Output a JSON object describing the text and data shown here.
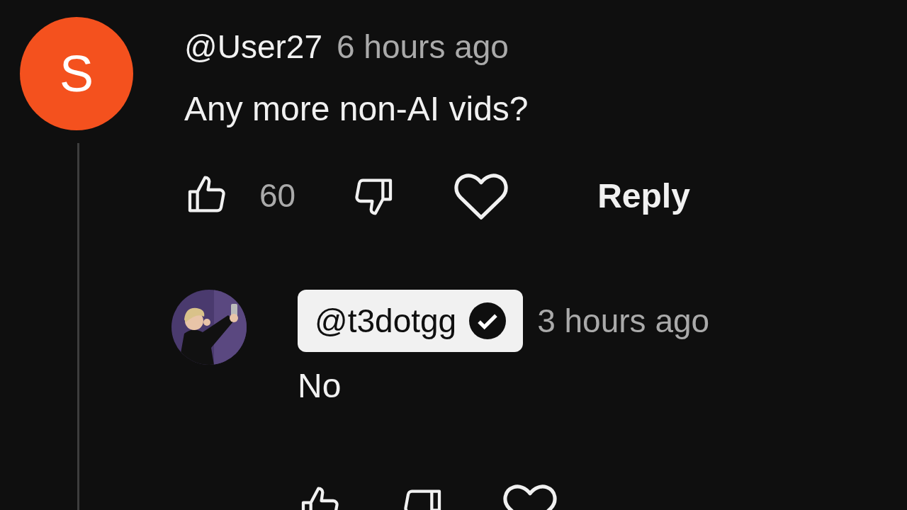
{
  "comments": [
    {
      "author": "@User27",
      "author_highlighted": false,
      "time": "6 hours ago",
      "text": "Any more non-AI vids?",
      "likes": "60",
      "reply_label": "Reply",
      "avatar": {
        "kind": "letter",
        "letter": "S"
      },
      "replies": [
        {
          "author": "@t3dotgg",
          "author_highlighted": true,
          "verified": true,
          "time": "3 hours ago",
          "text": "No"
        }
      ]
    }
  ]
}
